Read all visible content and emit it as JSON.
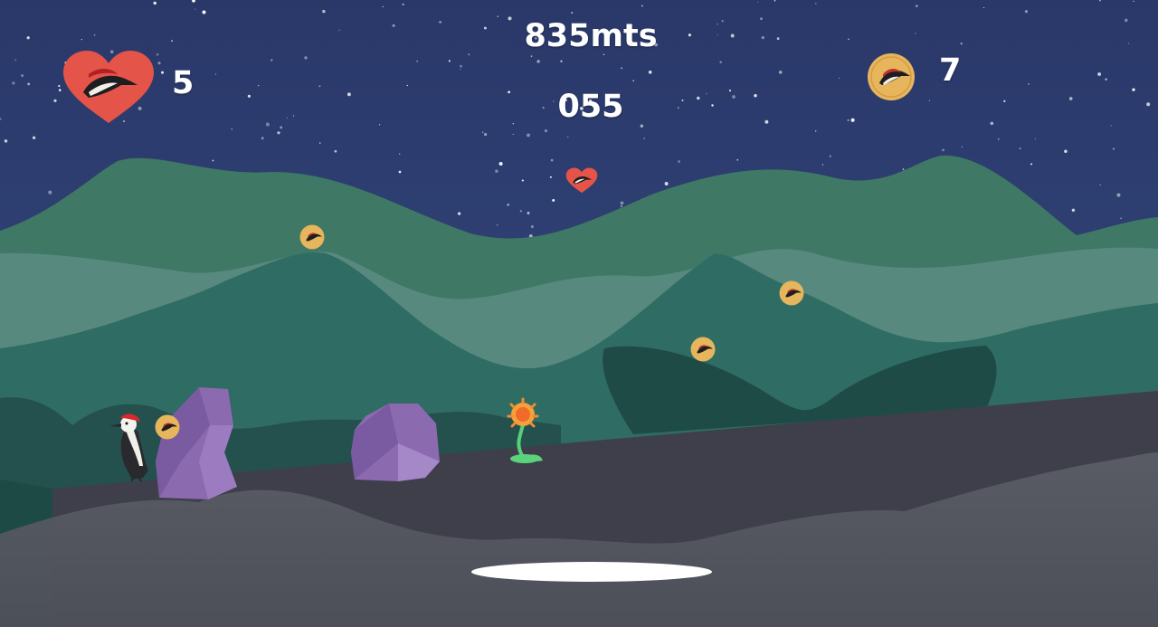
{
  "hud": {
    "distance": "835mts",
    "score": "055",
    "lives": "5",
    "coins": "7"
  },
  "icons": {
    "lives": "heart-bird-icon",
    "coins": "coin-bird-icon"
  },
  "colors": {
    "sky": "#2b3c6e",
    "heart": "#e55448",
    "coin": "#e6b55c",
    "ground": "#3e3f4a",
    "rock": "#8c6ab0"
  }
}
